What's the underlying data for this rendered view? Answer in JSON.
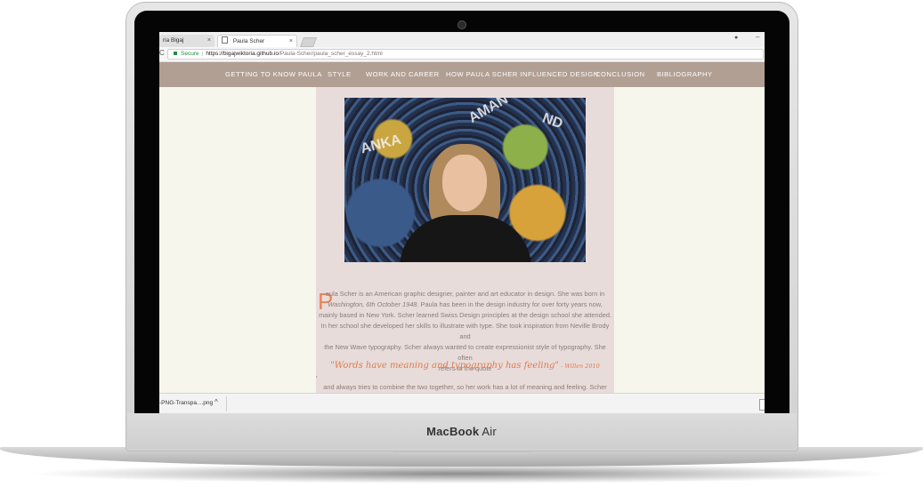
{
  "device": {
    "brand_plain": "MacBook",
    "brand_model": "Air"
  },
  "browser": {
    "tabs": [
      {
        "label": "ria Bigaj",
        "close": "×"
      },
      {
        "label": "Paula Scher",
        "close": "×"
      }
    ],
    "reload": "C",
    "secure_label": "Secure",
    "url_host": "https://bigajwiktoria.github.io",
    "url_path": "/Paula-Scher/paula_scher_essay_2.html",
    "account_icon": "●",
    "minimize": "–"
  },
  "nav": {
    "items": [
      "GETTING TO KNOW PAULA",
      "STYLE",
      "WORK AND CAREER",
      "HOW PAULA SCHER INFLUENCED DESIGN",
      "CONCLUSION",
      "BIBLIOGRAPHY"
    ]
  },
  "photo_words": [
    "ANKA",
    "AMAN",
    "ND"
  ],
  "essay": {
    "dropcap": "P",
    "p1_line1": "aula Scher is an American graphic designer, painter and art educator in design. She was born in",
    "p1_line2_italic": "Washington, 6th October 1948.",
    "p1_line2_rest": " Paula has been in the design industry for over forty years now,",
    "p1_line3": "mainly based in New York. Scher learned Swiss Design principles at the design school she attended.",
    "p1_line4": "In her school she developed her skills to illustrate with type. She took inspiration from Neville Brody and",
    "p1_line5": "the New Wave typography. Scher always wanted to create expressionist style of typography. She often",
    "p1_line6": "refers to the quote",
    "quote": "\"Words have meaning and typography has feeling\"",
    "quote_author": " - Willen 2010",
    "tick": "'",
    "p2_line1": "and always tries to combine the two together, so her work has a lot of meaning and feeling. Scher also"
  },
  "downloads": {
    "file": "-PNG-Transpa....png",
    "caret": "^"
  }
}
